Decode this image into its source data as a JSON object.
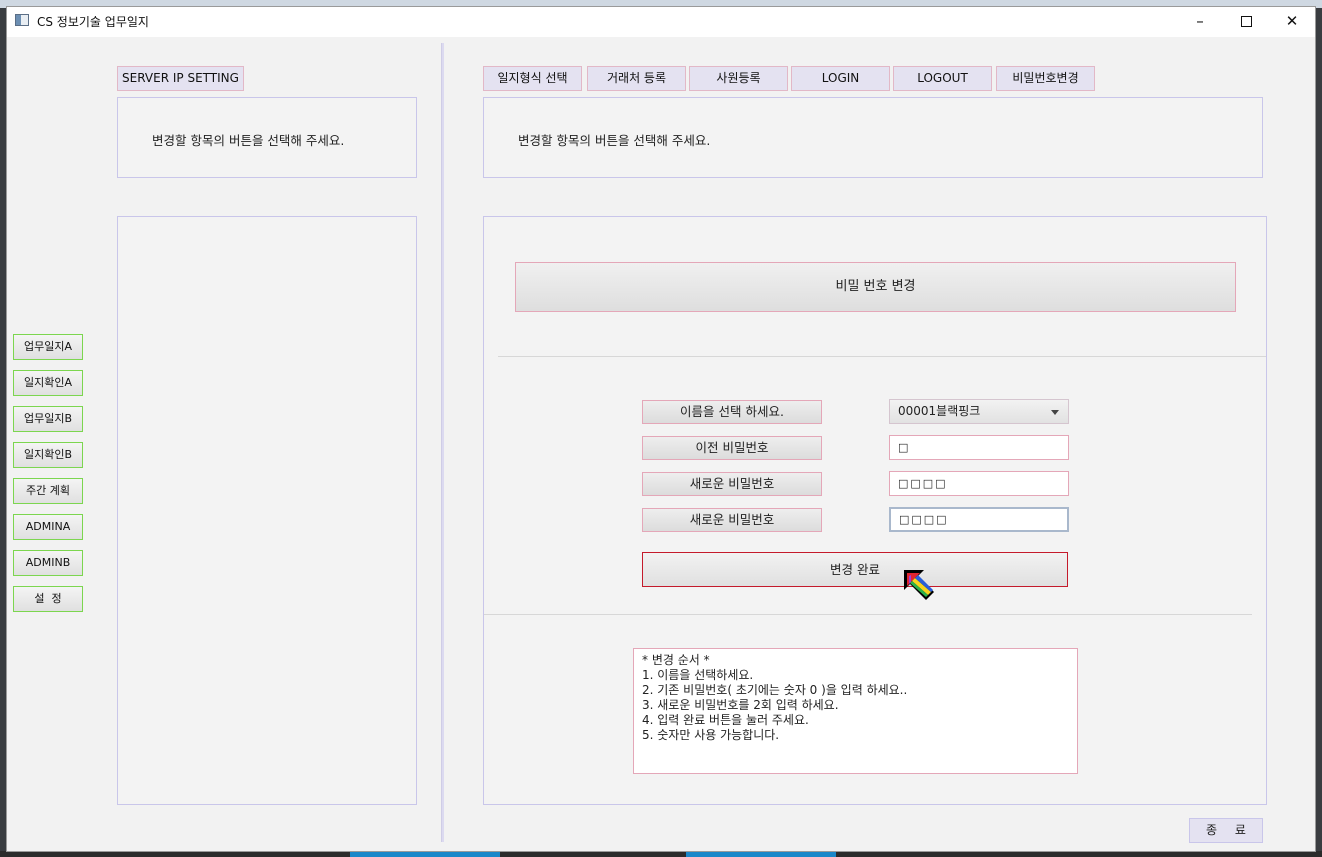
{
  "window": {
    "title": "CS 정보기술 업무일지",
    "controls": [
      "–",
      "",
      "✕"
    ]
  },
  "left_rail": {
    "items": [
      "업무일지A",
      "일지확인A",
      "업무일지B",
      "일지확인B",
      "주간 계획",
      "ADMINA",
      "ADMINB",
      "설  정"
    ]
  },
  "left_panel": {
    "server_ip_label": "SERVER IP SETTING",
    "hint": "변경할 항목의 버튼을 선택해 주세요."
  },
  "tabs": [
    "일지형식 선택",
    "거래처 등록",
    "사원등록",
    "LOGIN",
    "LOGOUT",
    "비밀번호변경"
  ],
  "right_panel": {
    "hint": "변경할 항목의 버튼을 선택해 주세요."
  },
  "password_change": {
    "header_button": "비밀 번호 변경",
    "name_label": "이름을 선택 하세요.",
    "name_selected": "00001블랙핑크",
    "old_pw_label": "이전 비밀번호",
    "old_pw_value": "□",
    "new_pw_label": "새로운 비밀번호",
    "new_pw_value": "□□□□",
    "confirm_pw_label": "새로운 비밀번호",
    "confirm_pw_value": "□□□□",
    "submit_button": "변경 완료"
  },
  "instructions": {
    "lines": [
      "* 변경 순서 *",
      "",
      "1. 이름을 선택하세요.",
      "2. 기존 비밀번호( 초기에는 숫자 0 )을 입력 하세요..",
      "3. 새로운 비밀번호를 2회 입력 하세요.",
      "4. 입력 완료 버튼을 눌러 주세요.",
      "5. 숫자만 사용 가능합니다."
    ]
  },
  "exit_button": "종 료",
  "colors": {
    "rail_border": "#7cd64f",
    "pink_border": "#e4a7b8",
    "submit_border": "#c41a2b",
    "tab_bg": "#e4e2f1"
  }
}
